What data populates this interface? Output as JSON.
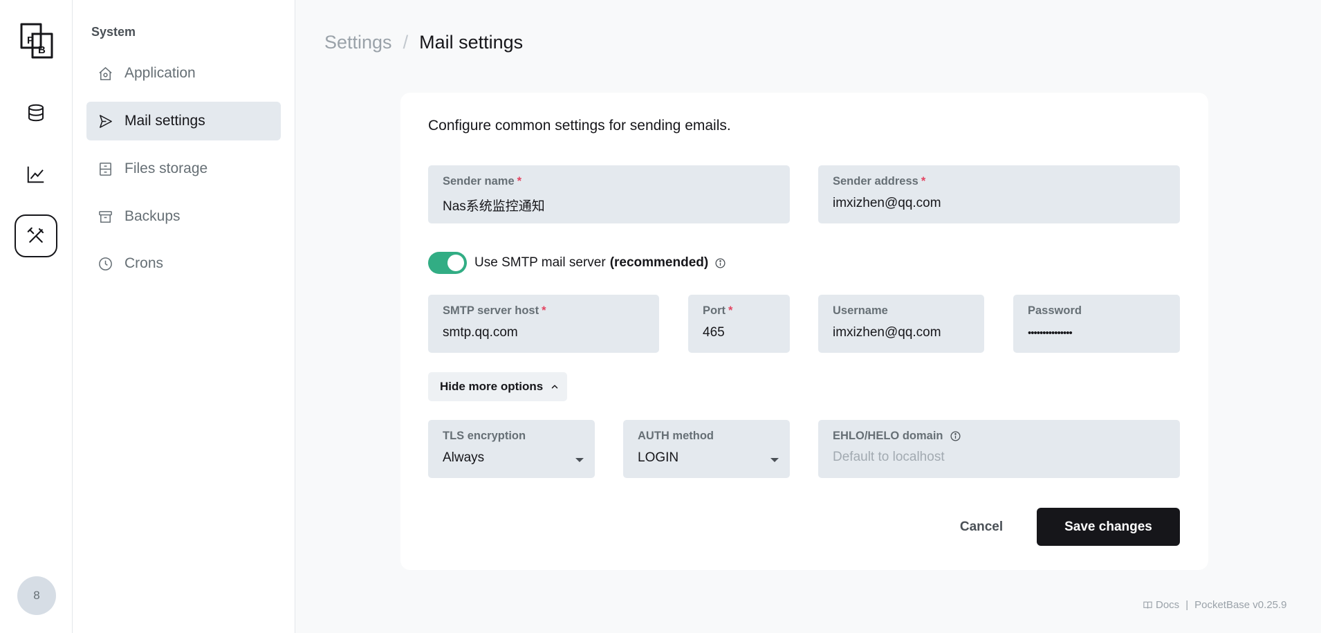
{
  "rail": {
    "items": [
      {
        "name": "collections",
        "icon": "database-icon"
      },
      {
        "name": "logs",
        "icon": "chart-line-icon"
      },
      {
        "name": "settings",
        "icon": "tools-icon",
        "active": true
      }
    ],
    "avatar_text": "8"
  },
  "logo": {
    "top": "P",
    "bottom": "B"
  },
  "sidebar": {
    "section_title": "System",
    "items": [
      {
        "label": "Application",
        "icon": "home-gear-icon"
      },
      {
        "label": "Mail settings",
        "icon": "send-plane-icon",
        "active": true
      },
      {
        "label": "Files storage",
        "icon": "archive-drawer-icon"
      },
      {
        "label": "Backups",
        "icon": "inbox-archive-icon"
      },
      {
        "label": "Crons",
        "icon": "clock-icon"
      }
    ]
  },
  "breadcrumb": {
    "parent": "Settings",
    "separator": "/",
    "current": "Mail settings"
  },
  "panel": {
    "description": "Configure common settings for sending emails.",
    "sender_name": {
      "label": "Sender name",
      "required": "*",
      "value": "Nas系统监控通知"
    },
    "sender_address": {
      "label": "Sender address",
      "required": "*",
      "value": "imxizhen@qq.com"
    },
    "smtp_toggle": {
      "label": "Use SMTP mail server",
      "label_strong": "(recommended)",
      "enabled": true
    },
    "smtp_host": {
      "label": "SMTP server host",
      "required": "*",
      "value": "smtp.qq.com"
    },
    "port": {
      "label": "Port",
      "required": "*",
      "value": "465"
    },
    "username": {
      "label": "Username",
      "value": "imxizhen@qq.com"
    },
    "password": {
      "label": "Password",
      "value": "•••••••••••••••"
    },
    "more_options_label": "Hide more options",
    "tls": {
      "label": "TLS encryption",
      "value": "Always"
    },
    "auth_method": {
      "label": "AUTH method",
      "value": "LOGIN"
    },
    "ehlo": {
      "label": "EHLO/HELO domain",
      "placeholder": "Default to localhost"
    },
    "cancel_label": "Cancel",
    "save_label": "Save changes"
  },
  "footer": {
    "docs_label": "Docs",
    "separator": "|",
    "version": "PocketBase v0.25.9"
  },
  "colors": {
    "accent_toggle": "#32ad84",
    "primary_button": "#16161a",
    "field_bg": "#e4e9ee",
    "required_mark": "#e34562"
  }
}
